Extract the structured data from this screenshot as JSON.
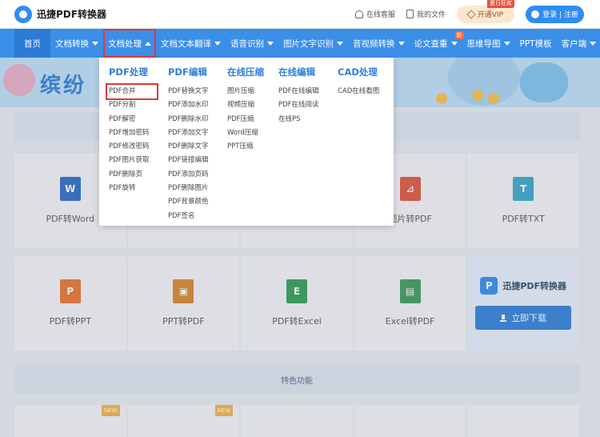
{
  "header": {
    "brand": "迅捷PDF转换器",
    "service": "在线客服",
    "my_files": "我的文件",
    "vip_label": "开通VIP",
    "vip_badge": "夏日狂欢",
    "login": "登录 | 注册"
  },
  "nav": {
    "items": [
      {
        "label": "首页"
      },
      {
        "label": "文档转换"
      },
      {
        "label": "文档处理"
      },
      {
        "label": "文档文本翻译"
      },
      {
        "label": "语音识别"
      },
      {
        "label": "图片文字识别"
      },
      {
        "label": "音视频转换"
      },
      {
        "label": "论文查重"
      },
      {
        "label": "思维导图"
      },
      {
        "label": "PPT模板"
      },
      {
        "label": "客户端"
      }
    ],
    "new_badge": "新"
  },
  "banner": {
    "title": "缤纷"
  },
  "dropdown": {
    "columns": [
      {
        "title": "PDF处理",
        "items": [
          "PDF合并",
          "PDF分割",
          "PDF解密",
          "PDF增加密码",
          "PDF修改密码",
          "PDF图片获取",
          "PDF删除页",
          "PDF旋转"
        ]
      },
      {
        "title": "PDF编辑",
        "items": [
          "PDF替换文字",
          "PDF添加水印",
          "PDF删除水印",
          "PDF添加文字",
          "PDF删除文字",
          "PDF链接编辑",
          "PDF添加页码",
          "PDF删除图片",
          "PDF背景颜色",
          "PDF签名"
        ]
      },
      {
        "title": "在线压缩",
        "items": [
          "图片压缩",
          "视频压缩",
          "PDF压缩",
          "Word压缩",
          "PPT压缩"
        ]
      },
      {
        "title": "在线编辑",
        "items": [
          "PDF在线编辑",
          "PDF在线阅读",
          "在线PS"
        ]
      },
      {
        "title": "CAD处理",
        "items": [
          "CAD在线看图"
        ]
      }
    ]
  },
  "cards": {
    "row1": [
      {
        "label": "PDF转Word",
        "icon": "W",
        "color": "#2b6cc4"
      },
      {
        "label": "",
        "icon": "",
        "color": "#e8ecf1"
      },
      {
        "label": "",
        "icon": "",
        "color": "#e8ecf1"
      },
      {
        "label": "图片转PDF",
        "icon": "⊿",
        "color": "#e0553b"
      },
      {
        "label": "PDF转TXT",
        "icon": "T",
        "color": "#3aa7c9"
      }
    ],
    "row2": [
      {
        "label": "PDF转PPT",
        "icon": "P",
        "color": "#e8742d"
      },
      {
        "label": "PPT转PDF",
        "icon": "▣",
        "color": "#d9862a"
      },
      {
        "label": "PDF转Excel",
        "icon": "E",
        "color": "#2f9e53"
      },
      {
        "label": "Excel转PDF",
        "icon": "▤",
        "color": "#3d9a5a"
      }
    ]
  },
  "promo": {
    "brand": "迅捷PDF转换器",
    "download": "立即下载"
  },
  "feature_strip": "特色功能",
  "new_tag": "NEW"
}
